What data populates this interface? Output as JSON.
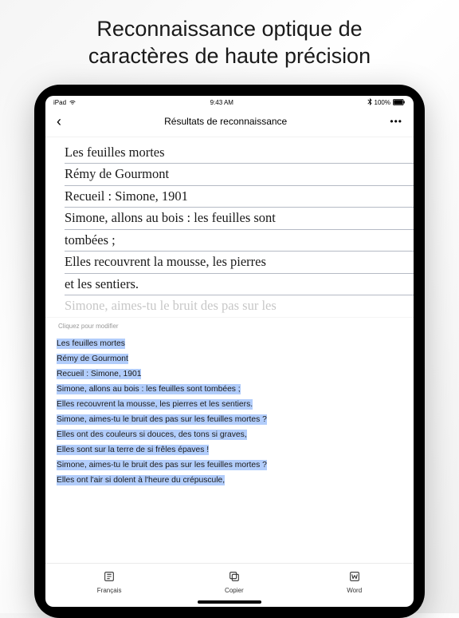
{
  "promo": {
    "title_line1": "Reconnaissance optique de",
    "title_line2": "caractères de haute précision"
  },
  "status_bar": {
    "device": "iPad",
    "wifi": "wifi",
    "time": "9:43 AM",
    "bt": "bt",
    "battery_pct": "100%"
  },
  "nav": {
    "back": "‹",
    "title": "Résultats de reconnaissance",
    "more": "•••"
  },
  "handwriting": {
    "lines": [
      "Les feuilles mortes",
      "Rémy de Gourmont",
      "Recueil : Simone, 1901",
      "Simone, allons au bois : les feuilles sont",
      "tombées ;",
      "Elles recouvrent la mousse, les pierres",
      "et les sentiers."
    ],
    "partial": "Simone, aimes-tu le bruit des pas sur les"
  },
  "edit_hint": "Cliquez pour modifier",
  "ocr": {
    "lines": [
      "Les feuilles mortes",
      "Rémy de Gourmont",
      "Recueil : Simone, 1901",
      "Simone, allons au bois : les feuilles sont tombées ;",
      "Elles recouvrent la mousse, les pierres et les sentiers.",
      "Simone, aimes-tu le bruit des pas sur les feuilles mortes ?",
      "Elles ont des couleurs si douces, des tons si graves,",
      "Elles sont sur la terre de si frêles épaves !",
      "Simone, aimes-tu le bruit des pas sur les feuilles mortes ?",
      "Elles ont l'air si dolent à l'heure du crépuscule,"
    ]
  },
  "bottom": {
    "lang": "Français",
    "copy": "Copier",
    "word": "Word"
  }
}
